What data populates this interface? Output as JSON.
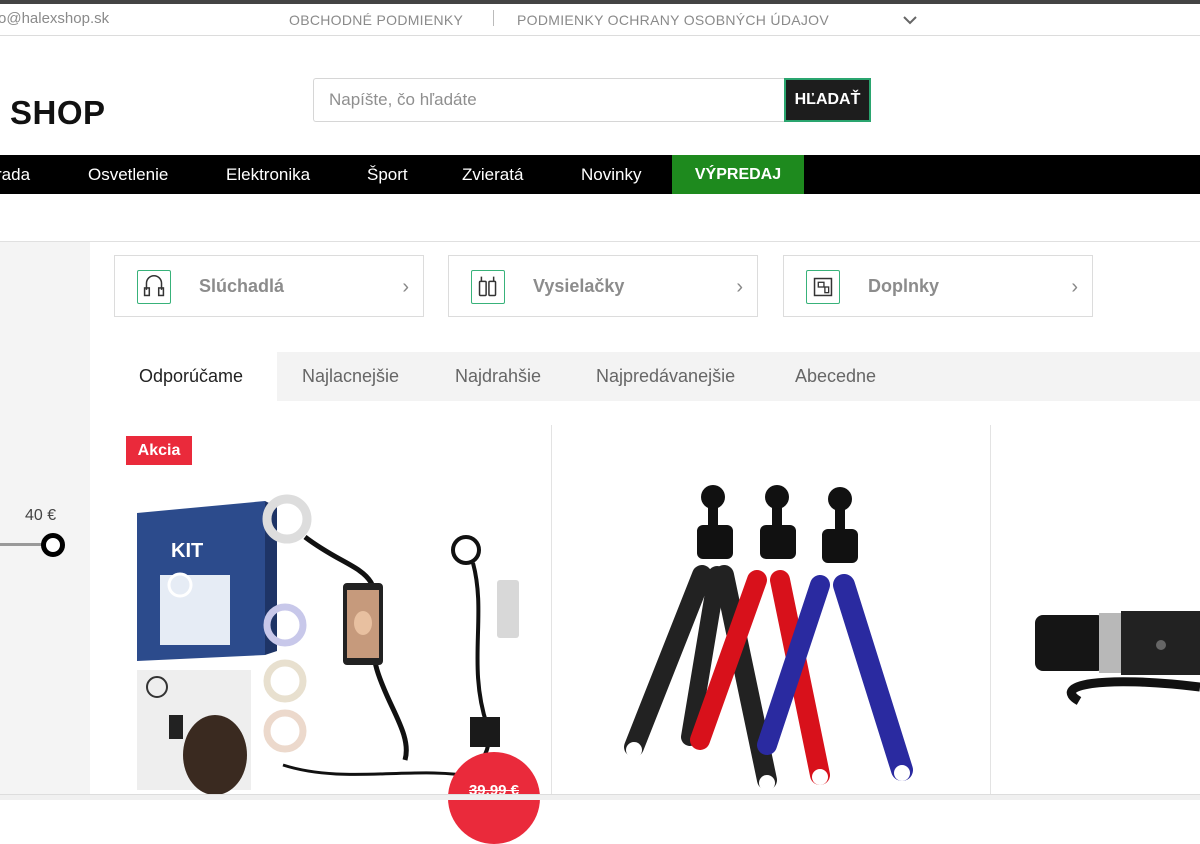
{
  "topbar": {
    "email": "o@halexshop.sk",
    "terms_link": "OBCHODNÉ PODMIENKY",
    "privacy_link": "PODMIENKY OCHRANY OSOBNÝCH ÚDAJOV"
  },
  "header": {
    "logo_text": "SHOP",
    "search_placeholder": "Napíšte, čo hľadáte",
    "search_button": "HĽADAŤ"
  },
  "nav": {
    "items": [
      "rada",
      "Osvetlenie",
      "Elektronika",
      "Šport",
      "Zvieratá",
      "Novinky"
    ],
    "sale": "VÝPREDAJ"
  },
  "sidebar": {
    "price_max": "40 €"
  },
  "subcategories": [
    {
      "label": "Slúchadlá",
      "icon": "headphones-icon"
    },
    {
      "label": "Vysielačky",
      "icon": "walkie-talkie-icon"
    },
    {
      "label": "Doplnky",
      "icon": "accessories-icon"
    }
  ],
  "sort_tabs": [
    "Odporúčame",
    "Najlacnejšie",
    "Najdrahšie",
    "Najpredávanejšie",
    "Abecedne"
  ],
  "products": [
    {
      "badge": "Akcia",
      "image": "ring-light-kit",
      "old_price": "39,99 €",
      "box_text": "KIT"
    },
    {
      "image": "flexible-tripods"
    },
    {
      "image": "flashlight"
    }
  ],
  "colors": {
    "nav_bg": "#000000",
    "sale_bg": "#1e8a1e",
    "badge_bg": "#ea2a3b",
    "accent_green": "#38b27a"
  }
}
